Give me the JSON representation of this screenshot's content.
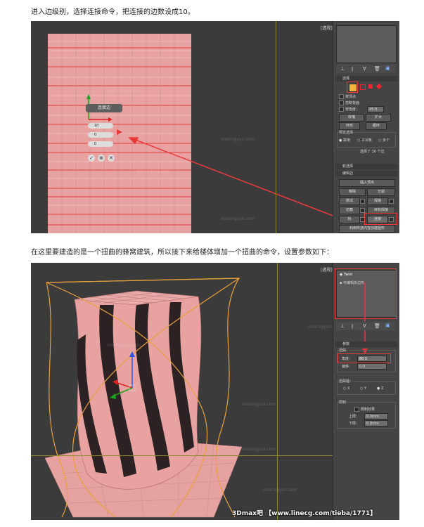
{
  "captions": {
    "step1": "进入边级别，选择连接命令，把连接的边数设成10。",
    "step2": "在这里要建造的是一个扭曲的蜂窝建筑，所以接下来给楼体增加一个扭曲的命令，设置参数如下："
  },
  "watermark": "mexingyun.com",
  "screen1": {
    "viewport_label": "[透视][真实]",
    "caddy": {
      "title": "连接边",
      "segments": "10",
      "pinch": "0",
      "slide": "0",
      "ok": "✓",
      "apply": "⊕",
      "cancel": "✕"
    },
    "panel": {
      "selection_title": "选择",
      "by_vertex": "按顶点",
      "ignore_backfacing": "忽略背面",
      "by_angle": "按角度：",
      "by_angle_value": "45.0",
      "shrink": "收缩",
      "grow": "扩大",
      "ring": "环形",
      "loop": "循环",
      "preview_selection": "预览选择",
      "preview_off": "禁用",
      "preview_subobj": "子对象",
      "preview_multi": "多个",
      "selected_count": "选择了 30 个边",
      "soft_selection": "软选择",
      "edit_edges": "编辑边",
      "insert_vertex": "插入顶点",
      "remove": "移除",
      "split": "分割",
      "extrude": "挤出",
      "weld": "焊接",
      "chamfer": "切角",
      "target_weld": "目标焊接",
      "bridge": "桥",
      "connect": "连接",
      "create_shape": "利用所选内容创建图形"
    }
  },
  "screen2": {
    "viewport_label": "[透视][真实]",
    "panel": {
      "modifier_twist": "Twist",
      "modifier_edit_poly": "可编辑多边形",
      "params_title": "参数",
      "twist_group": "扭曲：",
      "angle_label": "角度：",
      "angle_value": "80.5",
      "bias_label": "偏移：",
      "bias_value": "0.0",
      "twist_axis": "扭曲轴：",
      "axis_x": "X",
      "axis_y": "Y",
      "axis_z": "Z",
      "limits": "限制",
      "limit_effect": "限制效果",
      "upper_limit": "上限：",
      "upper_value": "0.0mm",
      "lower_limit": "下限：",
      "lower_value": "0.0mm"
    }
  },
  "footer": "3Dmax吧 【www.linecg.com/tieba/1771】",
  "colors": {
    "mesh": "#e8a2a2",
    "edge": "#e23b3b",
    "highlight": "#e83a3a",
    "viewport": "#3b3b3b",
    "panel": "#444444",
    "accent": "#f1b33f"
  }
}
